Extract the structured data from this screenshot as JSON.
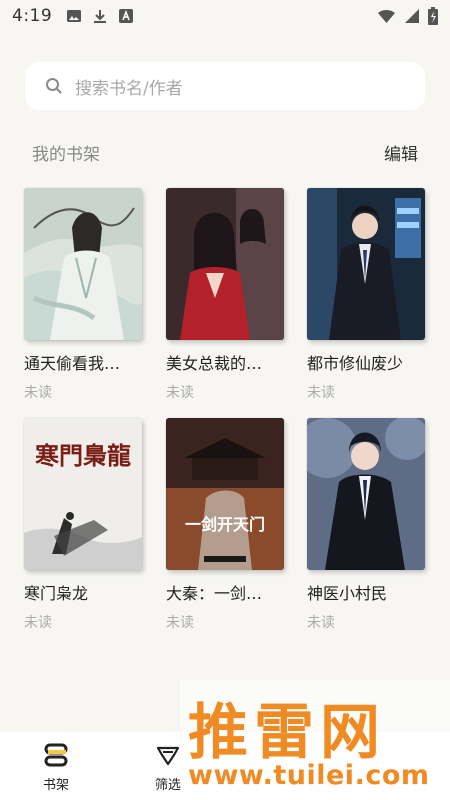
{
  "status_bar": {
    "time": "4:19",
    "left_icons": [
      "image-icon",
      "download-icon",
      "font-icon"
    ],
    "right_icons": [
      "wifi-icon",
      "signal-icon",
      "battery-icon"
    ]
  },
  "search": {
    "placeholder": "搜索书名/作者"
  },
  "shelf": {
    "title": "我的书架",
    "edit_label": "编辑"
  },
  "books": [
    {
      "title": "通天偷看我…",
      "status": "未读",
      "cover": "ancient-hero-cover"
    },
    {
      "title": "美女总裁的…",
      "status": "未读",
      "cover": "red-dress-cover"
    },
    {
      "title": "都市修仙废少",
      "status": "未读",
      "cover": "suit-man-cover"
    },
    {
      "title": "寒门枭龙",
      "status": "未读",
      "cover": "ink-calligraphy-cover",
      "cover_text": "寒門梟龍"
    },
    {
      "title": "大秦：一剑…",
      "status": "未读",
      "cover": "qin-palace-cover",
      "cover_text": "一剑开天门"
    },
    {
      "title": "神医小村民",
      "status": "未读",
      "cover": "doctor-man-cover"
    }
  ],
  "bottom_nav": [
    {
      "label": "书架",
      "icon": "bookshelf-icon"
    },
    {
      "label": "筛选",
      "icon": "filter-icon"
    }
  ],
  "watermark": {
    "big_text": "推雷网",
    "url": "www.tuilei.com"
  },
  "colors": {
    "background": "#f7f6f2",
    "watermark": "#f08a22"
  }
}
